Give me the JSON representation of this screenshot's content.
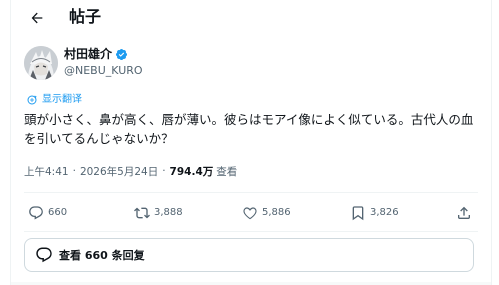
{
  "header": {
    "title": "帖子",
    "back_icon": "arrow-left-icon"
  },
  "author": {
    "name": "村田雄介",
    "handle": "@NEBU_KURO",
    "verified": true,
    "verified_color": "#1d9bf0"
  },
  "translate": {
    "label": "显示翻译",
    "icon": "translate-icon",
    "color": "#1d9bf0"
  },
  "tweet": {
    "text": "頭が小さく、鼻が高く、唇が薄い。彼らはモアイ像によく似ている。古代人の血を引いてるんじゃないか？",
    "time": "上午4:41",
    "date": "2026年5月24日",
    "views_count": "794.4万",
    "views_label": "查看"
  },
  "actions": {
    "reply_count": "660",
    "retweet_count": "3,888",
    "like_count": "5,886",
    "bookmark_count": "3,826"
  },
  "replies": {
    "label": "查看 660 条回复"
  },
  "colors": {
    "text": "#0f1419",
    "secondary": "#536471",
    "accent": "#1d9bf0",
    "border": "#eff3f4"
  }
}
